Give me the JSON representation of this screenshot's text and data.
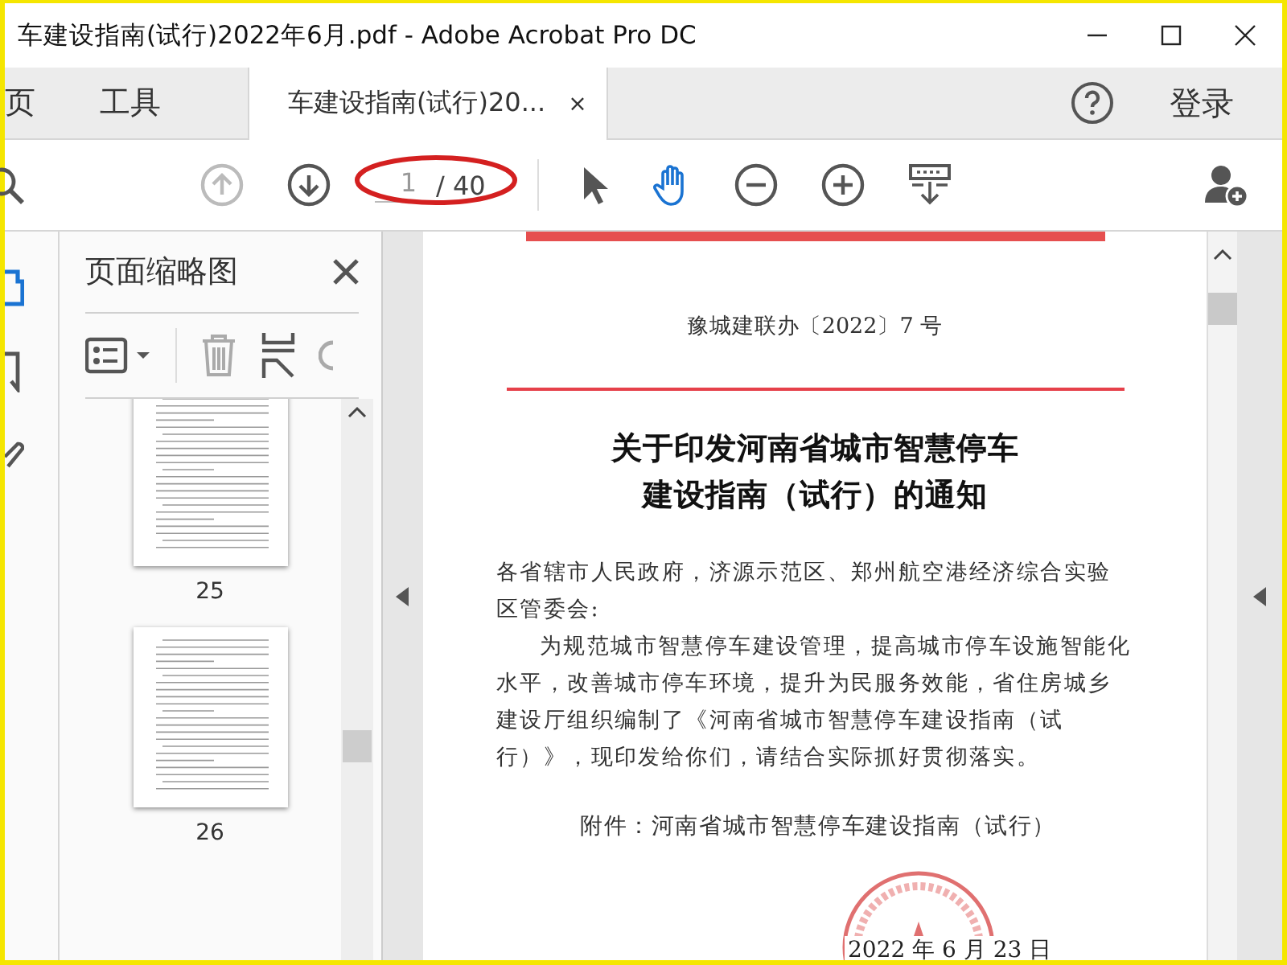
{
  "window": {
    "title": "车建设指南(试行)2022年6月.pdf - Adobe Acrobat Pro DC"
  },
  "tabs": [
    {
      "label": "页",
      "selected": false
    },
    {
      "label": "工具",
      "selected": false
    },
    {
      "label": "车建设指南(试行)20...",
      "selected": true,
      "close": "×"
    }
  ],
  "account": {
    "login": "登录"
  },
  "toolbar": {
    "page_value": "1",
    "page_total": "/ 40",
    "hand_tool_selected": true
  },
  "thumbnail_panel": {
    "title": "页面缩略图",
    "pages": [
      {
        "label": "25"
      },
      {
        "label": "26"
      }
    ]
  },
  "document": {
    "doc_number": "豫城建联办〔2022〕7 号",
    "title_lines": [
      "关于印发河南省城市智慧停车",
      "建设指南（试行）的通知"
    ],
    "salutation": "各省辖市人民政府，济源示范区、郑州航空港经济综合实验区管委会:",
    "body": "为规范城市智慧停车建设管理，提高城市停车设施智能化水平，改善城市停车环境，提升为民服务效能，省住房城乡建设厅组织编制了《河南省城市智慧停车建设指南（试行）》，现印发给你们，请结合实际抓好贯彻落实。",
    "attachment": "附件：河南省城市智慧停车建设指南（试行）",
    "date": "2022 年 6 月 23 日"
  }
}
